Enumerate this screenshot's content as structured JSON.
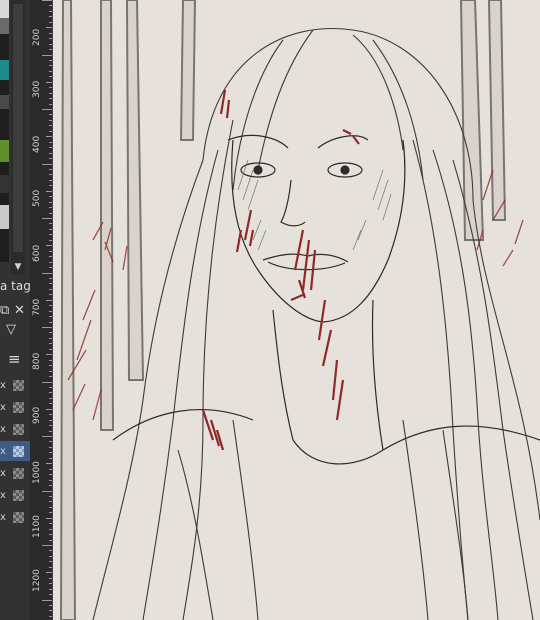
{
  "panel": {
    "tag_label": "a tag",
    "icons": [
      "tab-float-icon",
      "close-icon",
      "filter-icon",
      "menu-icon",
      "scroll-down-icon"
    ],
    "layer_rows": 7,
    "selected_layer_index": 3,
    "accent": "#3e5b82"
  },
  "ruler": {
    "labels": [
      "200",
      "300",
      "400",
      "500",
      "600",
      "700",
      "800",
      "900",
      "1000",
      "1100",
      "1200"
    ]
  },
  "canvas": {
    "paper_color": "#e7e3dc",
    "ink_color": "#2b2b2b",
    "blood_color": "#8e2a2a"
  }
}
